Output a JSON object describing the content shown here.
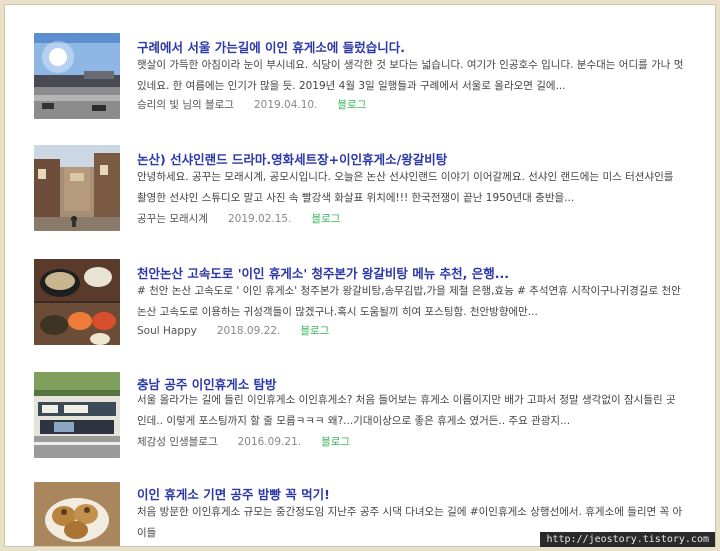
{
  "items": [
    {
      "title": "구례에서 서울 가는길에 이인 휴게소에 들렀습니다.",
      "snippet": "햇살이 가득한 아침이라 눈이 부시네요. 식당이 생각한 것 보다는 넓습니다. 여기가 인공호수 입니다. 분수대는 어디를 가나 멋있네요. 한 여름에는 인기가 많을 듯. 2019년 4월 3일 일행들과 구례에서 서울로 올라오면 길에...",
      "author": "승리의 빛 님의 블로그",
      "date": "2019.04.10.",
      "tag": "블로그"
    },
    {
      "title": "논산) 선샤인랜드 드라마.영화세트장+이인휴게소/왕갈비탕",
      "snippet": "안녕하세요. 공꾸는 모래시계, 공모시입니다. 오늘은 논산 선샤인랜드 이야기 이어갈께요. 선샤인 랜드에는 미스 터션샤인를 촬영한 선샤인 스튜디오 말고 사진 속 빨강색 화살표 위치에!!! 한국전쟁이 끝난 1950년대 충반을...",
      "author": "공꾸는 모래시계",
      "date": "2019.02.15.",
      "tag": "블로그"
    },
    {
      "title": "천안논산 고속도로 '이인 휴게소' 청주본가 왕갈비탕 메뉴 추천, 은행...",
      "snippet": "# 천안 논산 고속도로 ' 이인 휴게소' 청주본가 왕갈비탕,송무김밥,가을 제철 은행,효능 # 추석연휴 시작이구나귀경길로 천안 논산 고속도로 이용하는 귀성객들이 많겠구나.혹시 도움될끼 히여 포스팅함. 천안방향에만...",
      "author": "Soul Happy",
      "date": "2018.09.22.",
      "tag": "블로그"
    },
    {
      "title": "충남 공주 이인휴게소 탐방",
      "snippet": "서울 올라가는 길에 들린 이인휴게소 이인휴게소? 처음 들어보는 휴게소 이름이지만 배가 고파서 정말 생각없이 잠시들린 곳인데.. 이렇게 포스팅까지 할 줄 모름ㅋㅋㅋ 왜?...기대이상으로 좋은 휴게소 였거든.. 주요 관광지...",
      "author": "체감성 인생블로그",
      "date": "2016.09.21.",
      "tag": "블로그"
    },
    {
      "title": "이인 휴게소 기면 공주 밤빵 꼭 먹기!",
      "snippet": "처음 방문한 이인휴게소 규모는 중간정도임 지난주 공주 시댁 다녀오는 길에 #이인휴게소 상행선에서. 휴게소에 들리면 꼭 아이들",
      "author": "",
      "date": "",
      "tag": ""
    }
  ],
  "watermark": "http://jeostory.tistory.com"
}
